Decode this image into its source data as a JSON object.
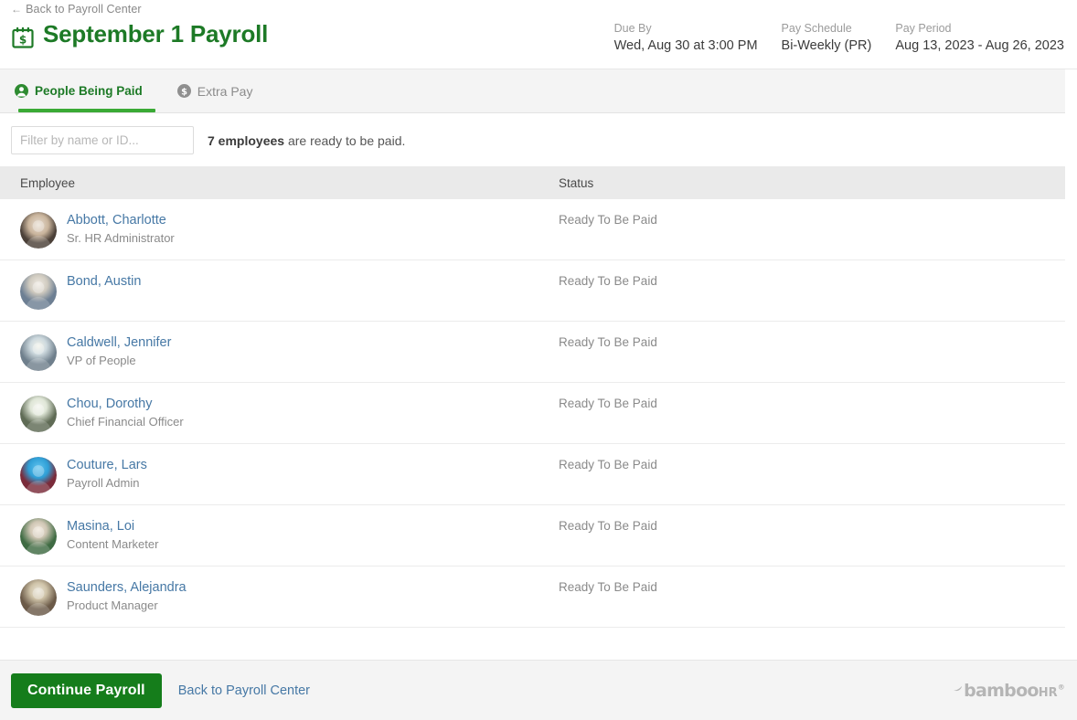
{
  "header": {
    "back_link": "Back to Payroll Center",
    "back_arrow": "←",
    "title": "September 1 Payroll",
    "calendar_icon": "calendar-dollar-icon",
    "meta": [
      {
        "label": "Due By",
        "value": "Wed, Aug 30 at 3:00 PM"
      },
      {
        "label": "Pay Schedule",
        "value": "Bi-Weekly (PR)"
      },
      {
        "label": "Pay Period",
        "value": "Aug 13, 2023 - Aug 26, 2023"
      }
    ]
  },
  "tabs": [
    {
      "label": "People Being Paid",
      "icon": "person-circle-icon",
      "active": true
    },
    {
      "label": "Extra Pay",
      "icon": "dollar-circle-icon",
      "active": false
    }
  ],
  "filter": {
    "placeholder": "Filter by name or ID...",
    "value": "",
    "ready_count": "7 employees",
    "ready_suffix": " are ready to be paid."
  },
  "table": {
    "columns": {
      "employee": "Employee",
      "status": "Status"
    },
    "rows": [
      {
        "name": "Abbott, Charlotte",
        "title": "Sr. HR Administrator",
        "status": "Ready To Be Paid"
      },
      {
        "name": "Bond, Austin",
        "title": "",
        "status": "Ready To Be Paid"
      },
      {
        "name": "Caldwell, Jennifer",
        "title": "VP of People",
        "status": "Ready To Be Paid"
      },
      {
        "name": "Chou, Dorothy",
        "title": "Chief Financial Officer",
        "status": "Ready To Be Paid"
      },
      {
        "name": "Couture, Lars",
        "title": "Payroll Admin",
        "status": "Ready To Be Paid"
      },
      {
        "name": "Masina, Loi",
        "title": "Content Marketer",
        "status": "Ready To Be Paid"
      },
      {
        "name": "Saunders, Alejandra",
        "title": "Product Manager",
        "status": "Ready To Be Paid"
      }
    ]
  },
  "footer": {
    "primary_button": "Continue Payroll",
    "back_link": "Back to Payroll Center",
    "logo_name": "bamboo",
    "logo_suffix": "HR",
    "logo_reg": "®"
  },
  "colors": {
    "brand_green": "#1d7a26",
    "tab_underline": "#3aaa35",
    "link_blue": "#4678a5",
    "button_green": "#157d1b"
  }
}
